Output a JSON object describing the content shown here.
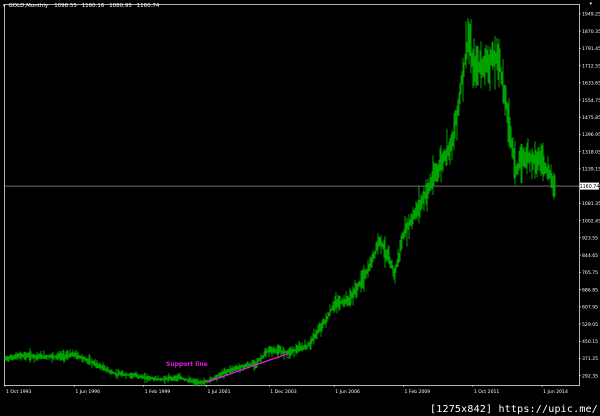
{
  "header": {
    "symbol": "GOLD,Monthly",
    "open": "1098.55",
    "high": "1160.16",
    "low": "1080.95",
    "close": "1160.74",
    "corner_marker": "▾"
  },
  "price_axis": {
    "ticks": [
      "1949.25",
      "1870.35",
      "1791.45",
      "1712.55",
      "1633.65",
      "1554.75",
      "1475.85",
      "1396.95",
      "1318.05",
      "1239.15",
      "1160.25",
      "1081.35",
      "1002.45",
      "923.55",
      "844.65",
      "765.75",
      "686.85",
      "607.95",
      "529.05",
      "450.15",
      "371.25",
      "292.35"
    ],
    "current_price": "1160.74"
  },
  "time_axis": {
    "labels": [
      "1 Oct 1993",
      "1 Jun 1996",
      "1 Feb 1999",
      "1 Jul 2001",
      "1 Dec 2003",
      "1 Jun 2006",
      "1 Feb 2009",
      "1 Oct 2011",
      "1 Jun 2014"
    ]
  },
  "annotation": {
    "text": "Support line",
    "color": "#e619e6"
  },
  "colors": {
    "background": "#000000",
    "bars": "#00b400",
    "axis": "#ffffff",
    "current_line": "#b4b4b4",
    "annotation": "#e619e6"
  },
  "chart_data": {
    "type": "line",
    "title": "",
    "xlabel": "",
    "ylabel": "",
    "ylim": [
      250,
      1990
    ],
    "x": [
      "1993-10",
      "1994-06",
      "1995-03",
      "1996-01",
      "1996-06",
      "1997-03",
      "1998-01",
      "1998-10",
      "1999-02",
      "1999-10",
      "2000-06",
      "2001-03",
      "2001-07",
      "2002-06",
      "2003-06",
      "2003-12",
      "2004-09",
      "2005-06",
      "2006-03",
      "2006-06",
      "2007-01",
      "2007-10",
      "2008-03",
      "2008-10",
      "2009-02",
      "2009-12",
      "2010-06",
      "2011-01",
      "2011-08",
      "2011-10",
      "2012-03",
      "2012-10",
      "2013-06",
      "2013-10",
      "2014-06",
      "2014-12"
    ],
    "series": [
      {
        "values": [
          370,
          385,
          380,
          382,
          390,
          350,
          300,
          295,
          285,
          275,
          285,
          260,
          265,
          320,
          350,
          410,
          400,
          430,
          560,
          620,
          640,
          780,
          920,
          760,
          940,
          1120,
          1240,
          1380,
          1850,
          1700,
          1720,
          1750,
          1230,
          1300,
          1280,
          1160
        ]
      }
    ],
    "support_line": {
      "from": {
        "x": "2001-07",
        "y": 262
      },
      "to": {
        "x": "2004-09",
        "y": 395
      }
    }
  }
}
